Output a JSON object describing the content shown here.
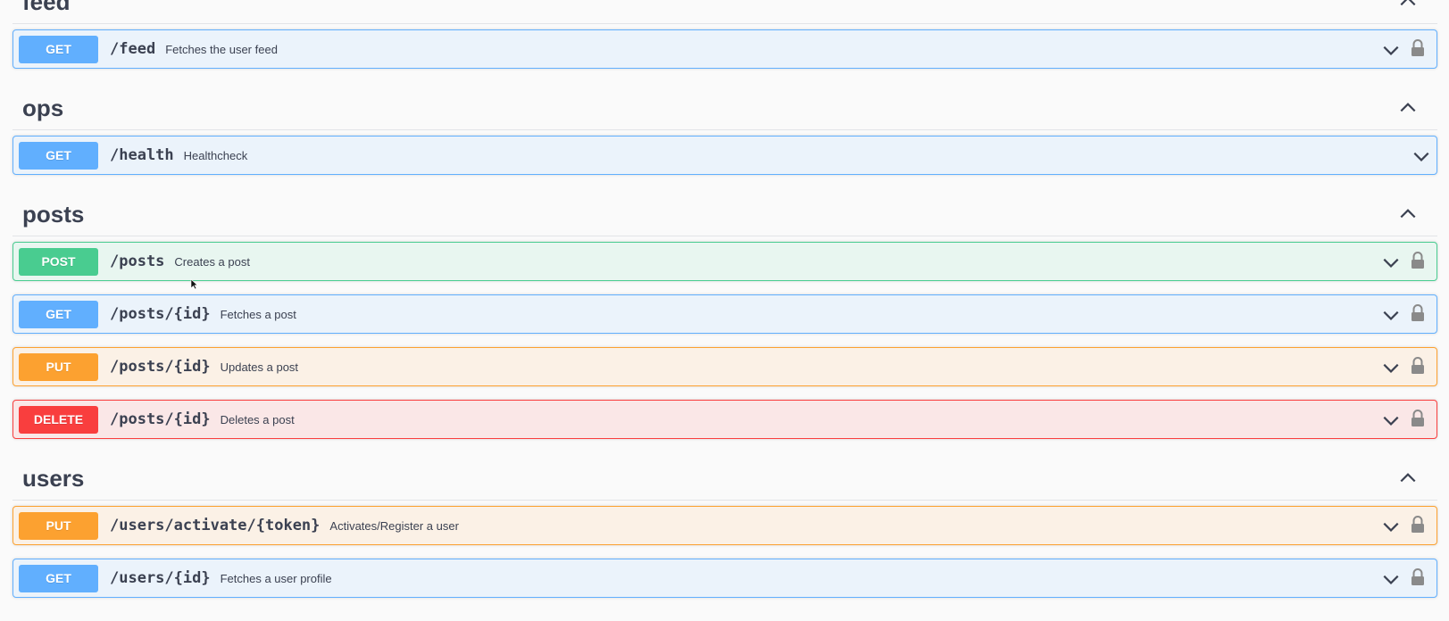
{
  "sections": [
    {
      "title": "feed"
    },
    {
      "title": "ops"
    },
    {
      "title": "posts"
    },
    {
      "title": "users"
    }
  ],
  "operations": [
    {
      "method": "GET",
      "path": "/feed",
      "summary": "Fetches the user feed",
      "locked": true
    },
    {
      "method": "GET",
      "path": "/health",
      "summary": "Healthcheck",
      "locked": false
    },
    {
      "method": "POST",
      "path": "/posts",
      "summary": "Creates a post",
      "locked": true
    },
    {
      "method": "GET",
      "path": "/posts/{id}",
      "summary": "Fetches a post",
      "locked": true
    },
    {
      "method": "PUT",
      "path": "/posts/{id}",
      "summary": "Updates a post",
      "locked": true
    },
    {
      "method": "DELETE",
      "path": "/posts/{id}",
      "summary": "Deletes a post",
      "locked": true
    },
    {
      "method": "PUT",
      "path": "/users/activate/{token}",
      "summary": "Activates/Register a user",
      "locked": true
    },
    {
      "method": "GET",
      "path": "/users/{id}",
      "summary": "Fetches a user profile",
      "locked": true
    }
  ],
  "icons": {
    "section_toggle": "chevron-up-icon",
    "op_toggle": "chevron-down-icon",
    "auth": "lock-icon"
  },
  "colors": {
    "get": "#61affe",
    "post": "#49cc90",
    "put": "#fca130",
    "delete": "#f93e3e"
  }
}
